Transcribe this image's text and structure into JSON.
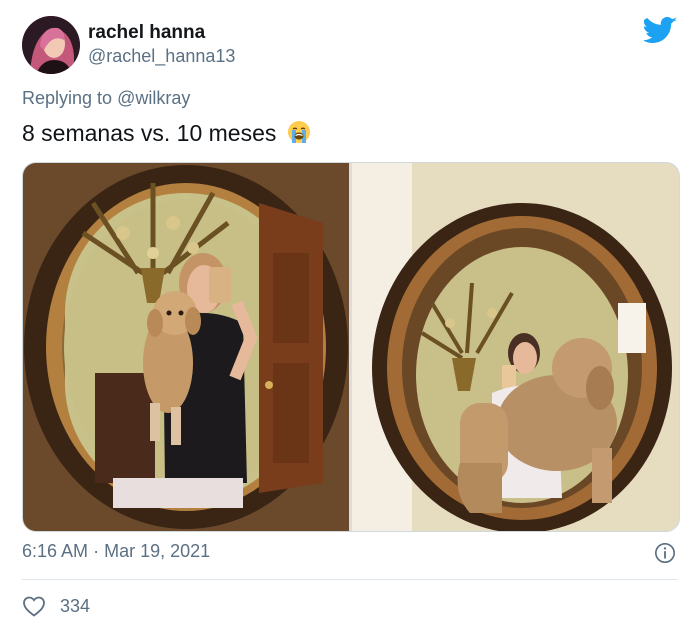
{
  "author": {
    "name": "rachel hanna",
    "handle": "@rachel_hanna13"
  },
  "reply": {
    "prefix": "Replying to",
    "mention": "@wilkray"
  },
  "tweet": {
    "text": "8 semanas vs. 10 meses",
    "emoji": "loudly-crying-face"
  },
  "media": {
    "images": [
      {
        "description": "woman holding small golden puppy in oval mirror selfie"
      },
      {
        "description": "woman holding large grown curly dog in oval mirror selfie"
      }
    ]
  },
  "meta": {
    "time": "6:16 AM",
    "separator": "·",
    "date": "Mar 19, 2021"
  },
  "stats": {
    "likes": "334"
  },
  "colors": {
    "brand": "#1da1f2",
    "secondary_text": "#5b7083",
    "divider": "#e1e8ed"
  }
}
